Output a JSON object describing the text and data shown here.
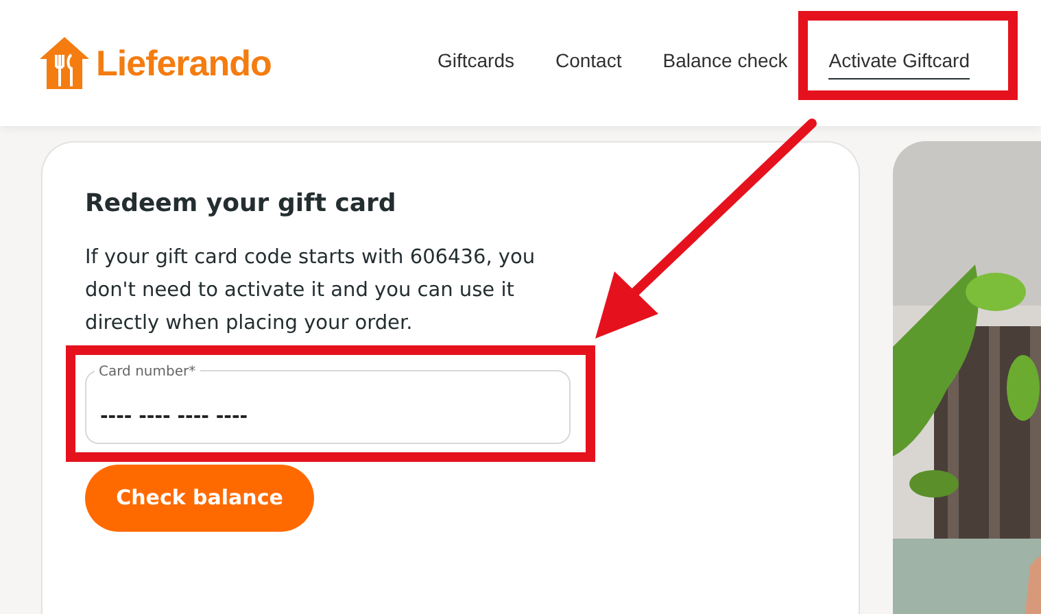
{
  "header": {
    "logo_text": "Lieferando",
    "nav": [
      {
        "label": "Giftcards",
        "selected": false
      },
      {
        "label": "Contact",
        "selected": false
      },
      {
        "label": "Balance check",
        "selected": false
      },
      {
        "label": "Activate Giftcard",
        "selected": true
      }
    ]
  },
  "card": {
    "title": "Redeem your gift card",
    "text": "If your gift card code starts with 606436, you don't need to activate it and you can use it directly when placing your order.",
    "field": {
      "label": "Card number*",
      "placeholder": "---- ---- ---- ----"
    },
    "button": "Check balance"
  }
}
